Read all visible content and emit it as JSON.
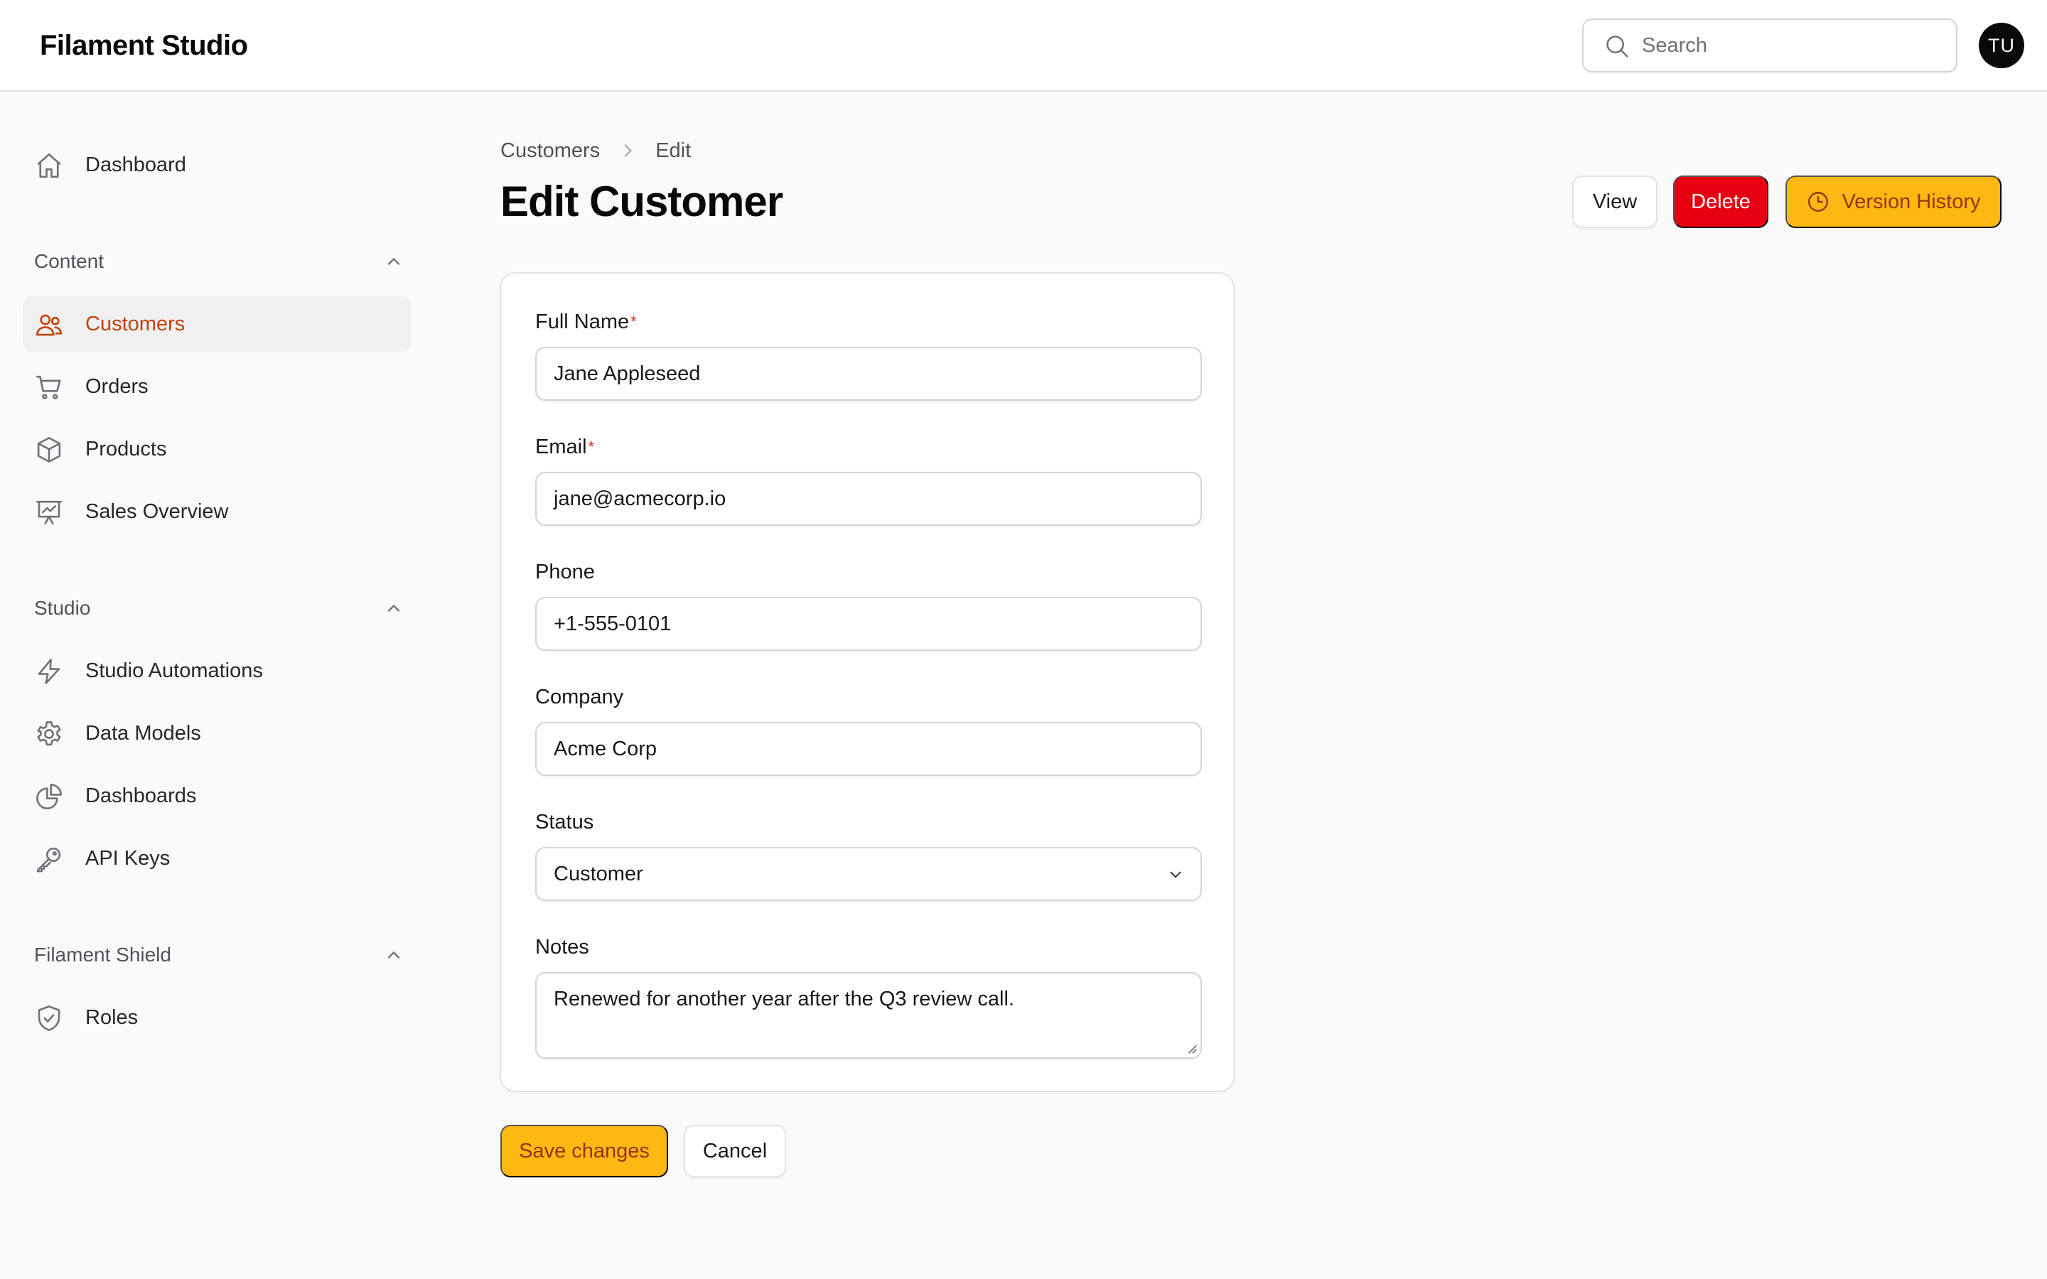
{
  "app": {
    "title": "Filament Studio"
  },
  "topbar": {
    "search_placeholder": "Search",
    "avatar_initials": "TU"
  },
  "sidebar": {
    "dashboard": {
      "label": "Dashboard",
      "icon": "home-icon"
    },
    "groups": [
      {
        "label": "Content",
        "items": [
          {
            "label": "Customers",
            "icon": "users-icon",
            "active": true
          },
          {
            "label": "Orders",
            "icon": "cart-icon"
          },
          {
            "label": "Products",
            "icon": "cube-icon"
          },
          {
            "label": "Sales Overview",
            "icon": "presentation-chart-icon"
          }
        ]
      },
      {
        "label": "Studio",
        "items": [
          {
            "label": "Studio Automations",
            "icon": "bolt-icon"
          },
          {
            "label": "Data Models",
            "icon": "cog-icon"
          },
          {
            "label": "Dashboards",
            "icon": "pie-chart-icon"
          },
          {
            "label": "API Keys",
            "icon": "key-icon"
          }
        ]
      },
      {
        "label": "Filament Shield",
        "items": [
          {
            "label": "Roles",
            "icon": "shield-check-icon"
          }
        ]
      }
    ]
  },
  "breadcrumb": {
    "parent": "Customers",
    "current": "Edit"
  },
  "page": {
    "title": "Edit Customer"
  },
  "header_actions": {
    "view": "View",
    "delete": "Delete",
    "version_history": "Version History"
  },
  "form": {
    "full_name": {
      "label": "Full Name",
      "required_mark": "*",
      "value": "Jane Appleseed"
    },
    "email": {
      "label": "Email",
      "required_mark": "*",
      "value": "jane@acmecorp.io"
    },
    "phone": {
      "label": "Phone",
      "value": "+1-555-0101"
    },
    "company": {
      "label": "Company",
      "value": "Acme Corp"
    },
    "status": {
      "label": "Status",
      "value": "Customer"
    },
    "notes": {
      "label": "Notes",
      "value": "Renewed for another year after the Q3 review call."
    }
  },
  "footer_actions": {
    "save": "Save changes",
    "cancel": "Cancel"
  },
  "colors": {
    "accent": "#fdb814",
    "accent_text": "#9a3412",
    "active_nav": "#c2410c",
    "danger": "#e70012"
  }
}
